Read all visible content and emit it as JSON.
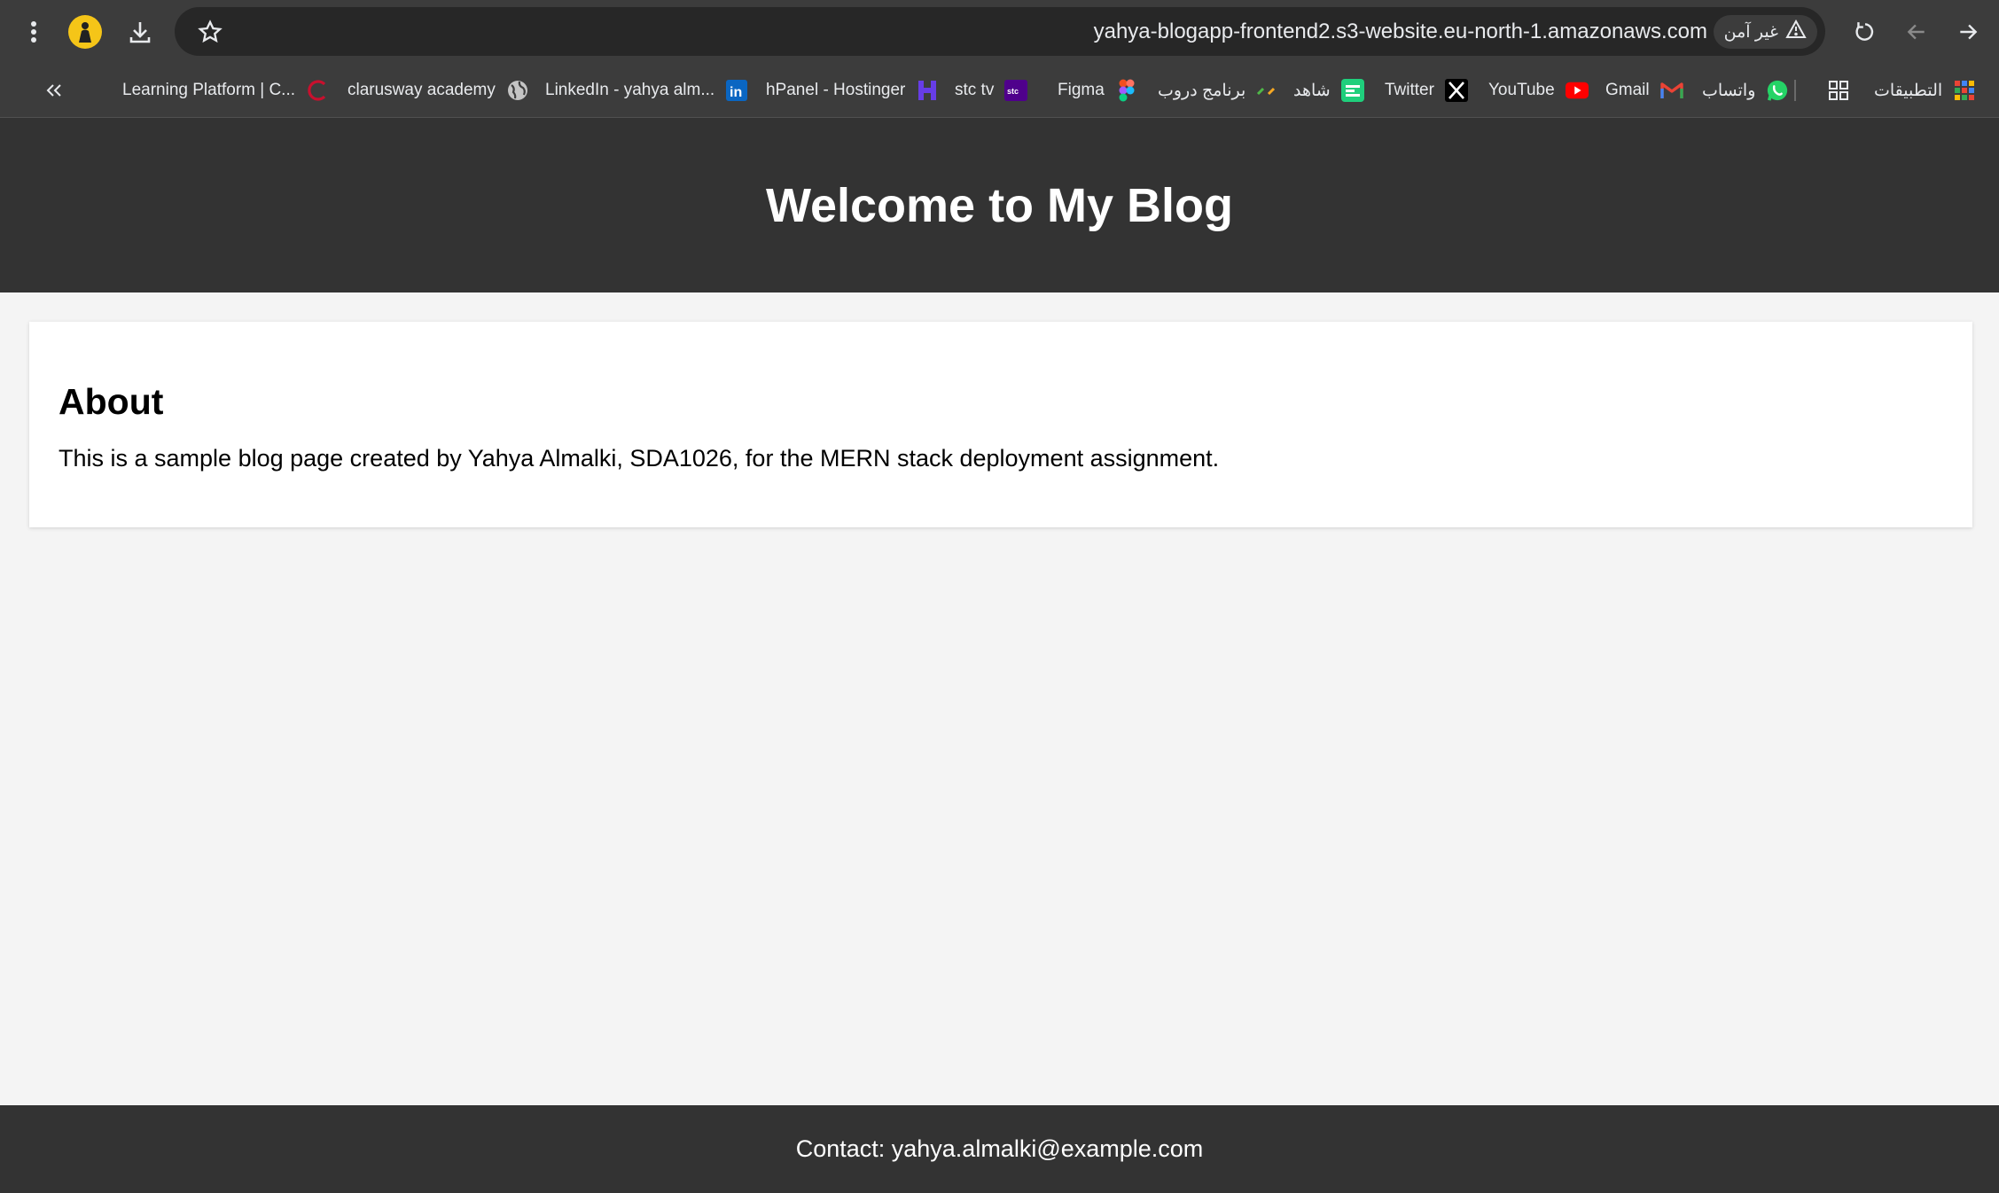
{
  "browser": {
    "url": "yahya-blogapp-frontend2.s3-website.eu-north-1.amazonaws.com",
    "security_label": "غير آمن",
    "icons": [
      "menu-dots-icon",
      "profile-icon",
      "download-icon",
      "star-icon",
      "warning-icon",
      "reload-icon",
      "back-arrow-icon",
      "forward-arrow-icon",
      "chevrons-left-icon",
      "apps-grid-icon"
    ],
    "bookmarks": [
      {
        "label": "التطبيقات",
        "icon": "apps-icon"
      },
      {
        "label": "",
        "icon": "tab-groups-icon"
      },
      {
        "label": "واتساب",
        "icon": "whatsapp-icon"
      },
      {
        "label": "Gmail",
        "icon": "gmail-icon"
      },
      {
        "label": "YouTube",
        "icon": "youtube-icon"
      },
      {
        "label": "Twitter",
        "icon": "x-icon"
      },
      {
        "label": "شاهد",
        "icon": "shahid-icon"
      },
      {
        "label": "برنامج دروب",
        "icon": "duroob-icon"
      },
      {
        "label": "Figma",
        "icon": "figma-icon"
      },
      {
        "label": "stc tv",
        "icon": "stctv-icon"
      },
      {
        "label": "hPanel - Hostinger",
        "icon": "hostinger-icon"
      },
      {
        "label": "LinkedIn - yahya alm...",
        "icon": "linkedin-icon"
      },
      {
        "label": "clarusway academy",
        "icon": "globe-icon"
      },
      {
        "label": "Learning Platform | C...",
        "icon": "clarusway-icon"
      }
    ],
    "colors": {
      "chrome": "#3c3c3c",
      "omnibox": "#272727",
      "text": "#e8eaed"
    }
  },
  "page": {
    "header": {
      "title": "Welcome to My Blog"
    },
    "about": {
      "heading": "About",
      "text": "This is a sample blog page created by Yahya Almalki, SDA1026, for the MERN stack deployment assignment."
    },
    "footer": {
      "contact": "Contact: yahya.almalki@example.com"
    },
    "colors": {
      "header_bg": "#333333",
      "body_bg": "#f4f4f4",
      "card_bg": "#ffffff"
    }
  }
}
